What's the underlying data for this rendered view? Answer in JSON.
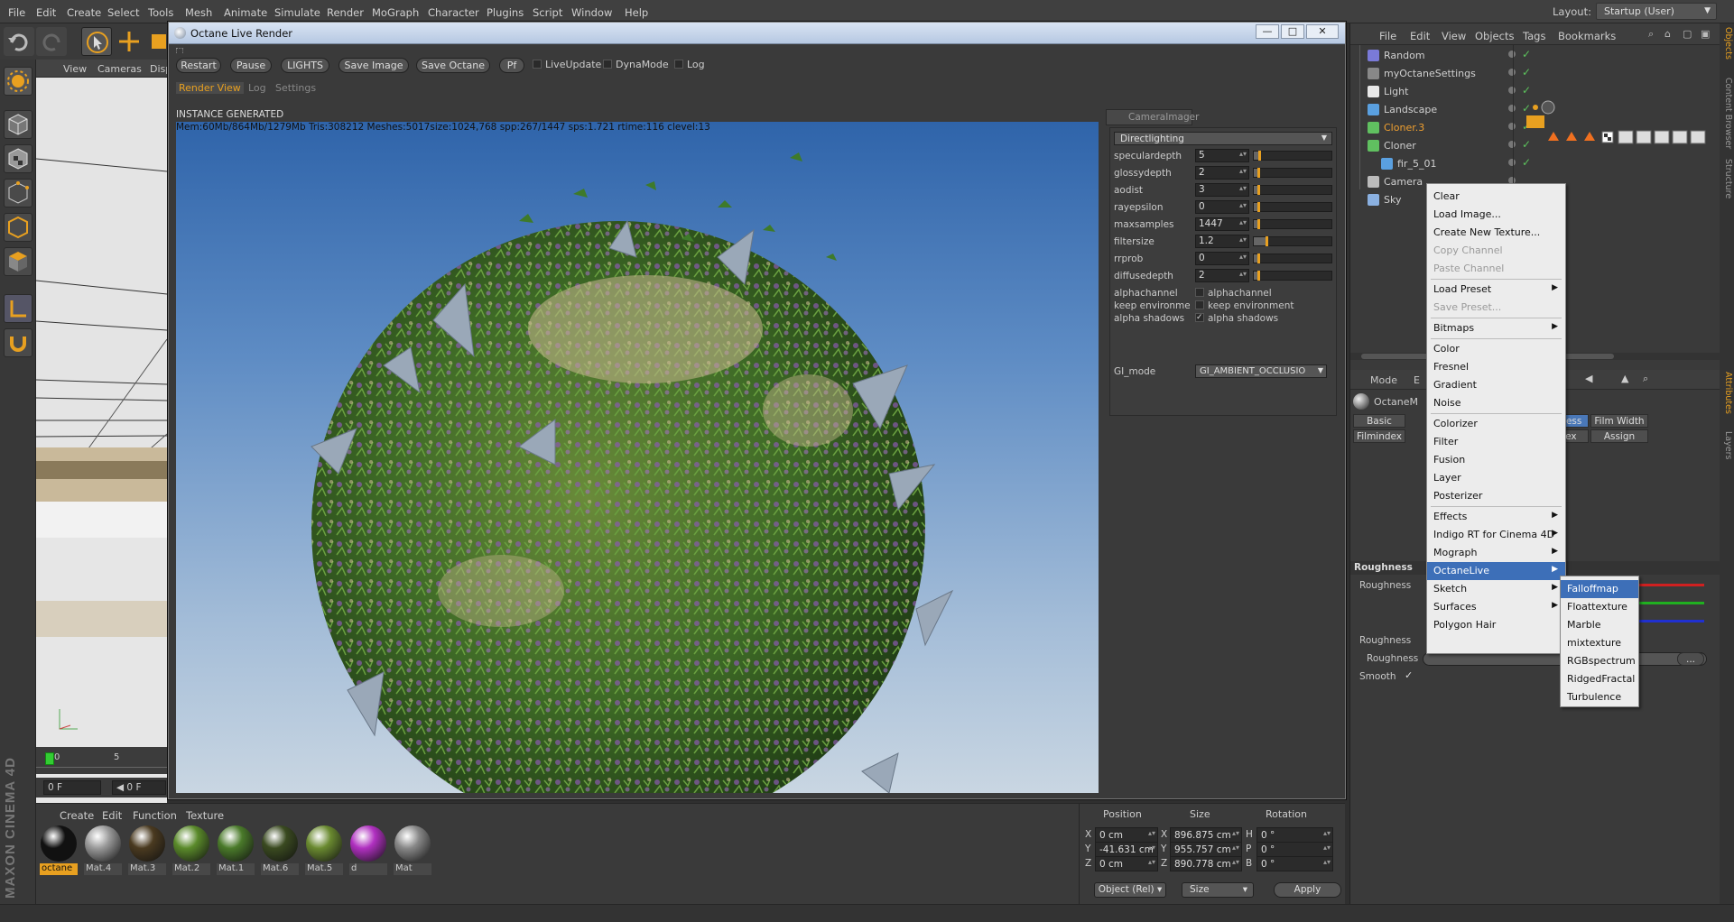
{
  "menubar": {
    "items": [
      "File",
      "Edit",
      "Create",
      "Select",
      "Tools",
      "Mesh",
      "Animate",
      "Simulate",
      "Render",
      "MoGraph",
      "Character",
      "Plugins",
      "Script",
      "Window",
      "Help"
    ],
    "layout_label": "Layout:",
    "layout_value": "Startup (User)"
  },
  "viewport": {
    "menu": [
      "View",
      "Cameras",
      "Disp"
    ],
    "axis": "x y z"
  },
  "timeline": {
    "ticks": [
      "0",
      "5"
    ],
    "frame_start": "0 F",
    "frame_current": "0 F"
  },
  "render_window": {
    "title": "Octane Live Render",
    "buttons": [
      "Restart",
      "Pause",
      "LIGHTS",
      "Save Image",
      "Save Octane",
      "Pf"
    ],
    "checks": [
      {
        "label": "LiveUpdate",
        "checked": false
      },
      {
        "label": "DynaMode",
        "checked": false
      },
      {
        "label": "Log",
        "checked": false
      }
    ],
    "tabs": [
      "Render View",
      "Log",
      "Settings"
    ],
    "status": "INSTANCE GENERATED",
    "stats": "Mem:60Mb/864Mb/1279Mb Tris:308212 Meshes:5017size:1024,768 spp:267/1447 sps:1.721 rtime:116 clevel:13"
  },
  "camera_imager": {
    "tab": "CameraImager",
    "kernel": "Directlighting",
    "params": [
      {
        "label": "speculardepth",
        "value": "5",
        "fill": 0.06
      },
      {
        "label": "glossydepth",
        "value": "2",
        "fill": 0.02
      },
      {
        "label": "aodist",
        "value": "3",
        "fill": 0.02
      },
      {
        "label": "rayepsilon",
        "value": "0",
        "fill": 0.0
      },
      {
        "label": "maxsamples",
        "value": "1447",
        "fill": 0.05
      },
      {
        "label": "filtersize",
        "value": "1.2",
        "fill": 0.15
      },
      {
        "label": "rrprob",
        "value": "0",
        "fill": 0.0
      },
      {
        "label": "diffusedepth",
        "value": "2",
        "fill": 0.02
      }
    ],
    "checks": [
      {
        "label": "alphachannel",
        "text": "alphachannel",
        "checked": false
      },
      {
        "label": "keep environme",
        "text": "keep environment",
        "checked": false
      },
      {
        "label": "alpha shadows",
        "text": "alpha shadows",
        "checked": true
      }
    ],
    "gi_label": "GI_mode",
    "gi_value": "GI_AMBIENT_OCCLUSIO"
  },
  "object_manager": {
    "menu": [
      "File",
      "Edit",
      "View",
      "Objects",
      "Tags",
      "Bookmarks"
    ],
    "objects": [
      {
        "name": "Random",
        "color": "#d0d0d0",
        "icon": "#7a7ad8"
      },
      {
        "name": "myOctaneSettings",
        "color": "#d0d0d0",
        "icon": "#888888"
      },
      {
        "name": "Light",
        "color": "#d0d0d0",
        "icon": "#e8e8e8"
      },
      {
        "name": "Landscape",
        "color": "#d0d0d0",
        "icon": "#5aa0e0"
      },
      {
        "name": "Cloner.3",
        "color": "#f0a030",
        "icon": "#60c060"
      },
      {
        "name": "Cloner",
        "color": "#d0d0d0",
        "icon": "#60c060"
      },
      {
        "name": "fir_5_01",
        "color": "#d0d0d0",
        "icon": "#5aa0e0"
      },
      {
        "name": "Camera",
        "color": "#d0d0d0",
        "icon": "#bbbbbb"
      },
      {
        "name": "Sky",
        "color": "#d0d0d0",
        "icon": "#8ab0e0"
      }
    ]
  },
  "attributes": {
    "mode": "Mode",
    "mode2": "E",
    "material": "OctaneM",
    "tabs_row1": [
      "Basic",
      "hness",
      "Film Width"
    ],
    "tabs_row2": [
      "Filmindex",
      "dex",
      "Assign"
    ],
    "section": "Roughness",
    "rows": [
      "Roughness",
      "Roughness",
      "Roughness",
      "Smooth"
    ],
    "more_btn": "..."
  },
  "context_menu": {
    "items": [
      {
        "label": "Clear",
        "disabled": false,
        "sub": false
      },
      {
        "label": "Load Image...",
        "disabled": false,
        "sub": false
      },
      {
        "label": "Create New Texture...",
        "disabled": false,
        "sub": false
      },
      {
        "label": "Copy Channel",
        "disabled": true,
        "sub": false
      },
      {
        "label": "Paste Channel",
        "disabled": true,
        "sub": false
      },
      {
        "label": "Load Preset",
        "disabled": false,
        "sub": true
      },
      {
        "label": "Save Preset...",
        "disabled": true,
        "sub": false
      },
      {
        "label": "Bitmaps",
        "disabled": false,
        "sub": true
      },
      {
        "label": "Color",
        "disabled": false,
        "sub": false
      },
      {
        "label": "Fresnel",
        "disabled": false,
        "sub": false
      },
      {
        "label": "Gradient",
        "disabled": false,
        "sub": false
      },
      {
        "label": "Noise",
        "disabled": false,
        "sub": false
      },
      {
        "label": "Colorizer",
        "disabled": false,
        "sub": false
      },
      {
        "label": "Filter",
        "disabled": false,
        "sub": false
      },
      {
        "label": "Fusion",
        "disabled": false,
        "sub": false
      },
      {
        "label": "Layer",
        "disabled": false,
        "sub": false
      },
      {
        "label": "Posterizer",
        "disabled": false,
        "sub": false
      },
      {
        "label": "Effects",
        "disabled": false,
        "sub": true
      },
      {
        "label": "Indigo RT for Cinema 4D",
        "disabled": false,
        "sub": true
      },
      {
        "label": "Mograph",
        "disabled": false,
        "sub": true
      },
      {
        "label": "OctaneLive",
        "disabled": false,
        "sub": true
      },
      {
        "label": "Sketch",
        "disabled": false,
        "sub": true
      },
      {
        "label": "Surfaces",
        "disabled": false,
        "sub": true
      },
      {
        "label": "Polygon Hair",
        "disabled": false,
        "sub": false
      }
    ],
    "submenu": [
      "Falloffmap",
      "Floattexture",
      "Marble",
      "mixtexture",
      "RGBspectrum",
      "RidgedFractal",
      "Turbulence"
    ]
  },
  "materials": {
    "menu": [
      "Create",
      "Edit",
      "Function",
      "Texture"
    ],
    "items": [
      {
        "name": "octane",
        "color": "#111111",
        "selected": true
      },
      {
        "name": "Mat.4",
        "color": "#9a9a9a",
        "selected": false
      },
      {
        "name": "Mat.3",
        "color": "#4a3a20",
        "selected": false
      },
      {
        "name": "Mat.2",
        "color": "#5a8a2a",
        "selected": false
      },
      {
        "name": "Mat.1",
        "color": "#4a7a2a",
        "selected": false
      },
      {
        "name": "Mat.6",
        "color": "#3a4a20",
        "selected": false
      },
      {
        "name": "Mat.5",
        "color": "#6a8a30",
        "selected": false
      },
      {
        "name": "d",
        "color": "#b030c0",
        "selected": false
      },
      {
        "name": "Mat",
        "color": "#888888",
        "selected": false
      }
    ]
  },
  "coordinates": {
    "headers": [
      "Position",
      "Size",
      "Rotation"
    ],
    "rows": [
      {
        "a": "X",
        "pos": "0 cm",
        "b": "X",
        "size": "896.875 cm",
        "c": "H",
        "rot": "0 °"
      },
      {
        "a": "Y",
        "pos": "-41.631 cm",
        "b": "Y",
        "size": "955.757 cm",
        "c": "P",
        "rot": "0 °"
      },
      {
        "a": "Z",
        "pos": "0 cm",
        "b": "Z",
        "size": "890.778 cm",
        "c": "B",
        "rot": "0 °"
      }
    ],
    "mode": "Object (Rel)",
    "size_mode": "Size",
    "apply": "Apply"
  },
  "right_tabs": [
    "Objects",
    "Content Browser",
    "Structure",
    "Attributes",
    "Layers"
  ],
  "brand": "MAXON CINEMA 4D"
}
